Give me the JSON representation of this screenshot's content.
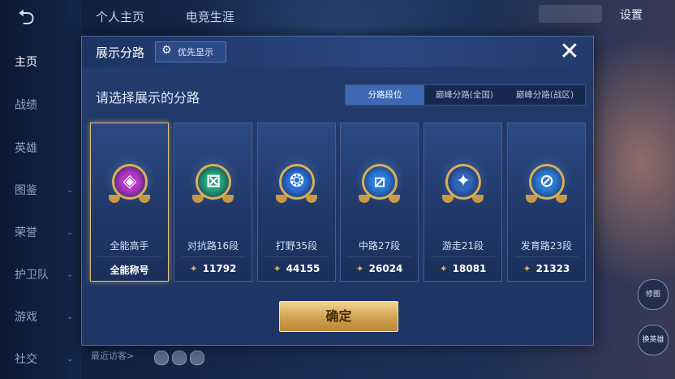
{
  "background": {
    "top_tabs": [
      "个人主页",
      "电竞生涯"
    ],
    "settings_label": "设置",
    "sidebar_items": [
      {
        "label": "主页",
        "active": true
      },
      {
        "label": "战绩"
      },
      {
        "label": "英雄"
      },
      {
        "label": "图鉴"
      },
      {
        "label": "荣誉"
      },
      {
        "label": "护卫队"
      },
      {
        "label": "游戏"
      },
      {
        "label": "社交"
      }
    ],
    "recent_visitors_label": "最近访客>",
    "right_buttons": [
      "修图",
      "换英雄"
    ]
  },
  "dialog": {
    "title": "展示分路",
    "priority_button": "优先显示",
    "prompt": "请选择展示的分路",
    "segments": [
      {
        "label": "分路段位",
        "active": true
      },
      {
        "label": "巅峰分路(全国)"
      },
      {
        "label": "巅峰分路(战区)"
      }
    ],
    "cards": [
      {
        "name": "全能高手",
        "score": "全能称号",
        "badge_color": "#b636c8",
        "glyph": "◈",
        "selected": true,
        "score_icon": false
      },
      {
        "name": "对抗路16段",
        "score": "11792",
        "badge_color": "#22a27a",
        "glyph": "⊠",
        "score_icon": true
      },
      {
        "name": "打野35段",
        "score": "44155",
        "badge_color": "#2c6fd6",
        "glyph": "❂",
        "score_icon": true
      },
      {
        "name": "中路27段",
        "score": "26024",
        "badge_color": "#2a79d8",
        "glyph": "⧄",
        "score_icon": true
      },
      {
        "name": "游走21段",
        "score": "18081",
        "badge_color": "#2f63b8",
        "glyph": "✦",
        "score_icon": true
      },
      {
        "name": "发育路23段",
        "score": "21323",
        "badge_color": "#2d7bd4",
        "glyph": "⊘",
        "score_icon": true
      }
    ],
    "confirm_label": "确定",
    "close_icon": "close-icon",
    "accent_color": "#d9b056"
  }
}
